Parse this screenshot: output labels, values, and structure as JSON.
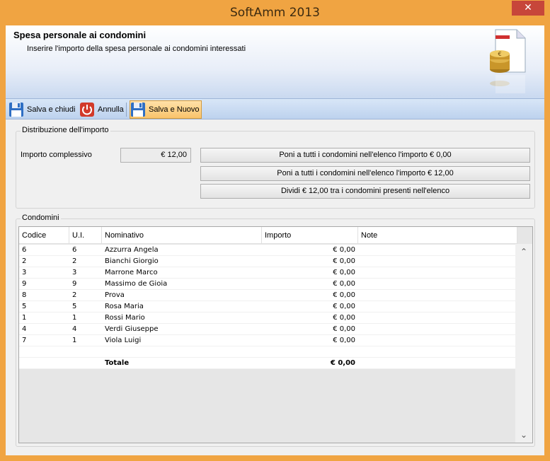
{
  "window": {
    "title": "SoftAmm 2013",
    "close_glyph": "✕"
  },
  "header": {
    "title": "Spesa personale ai condomini",
    "subtitle": "Inserire l'importo della spesa personale ai condomini interessati",
    "icon": "coins-document-icon"
  },
  "toolbar": {
    "save_close": "Salva e chiudi",
    "cancel": "Annulla",
    "save_new": "Salva e Nuovo"
  },
  "distribution": {
    "group_label": "Distribuzione dell'importo",
    "amount_label": "Importo complessivo",
    "amount_value": "€ 12,00",
    "btn_zero": "Poni a tutti i condomini nell'elenco l'importo € 0,00",
    "btn_all": "Poni a tutti i condomini nell'elenco l'importo € 12,00",
    "btn_divide": "Dividi € 12,00 tra i condomini presenti nell'elenco"
  },
  "condomini": {
    "group_label": "Condomini",
    "columns": [
      "Codice",
      "U.I.",
      "Nominativo",
      "Importo",
      "Note"
    ],
    "rows": [
      {
        "codice": "6",
        "ui": "6",
        "nome": "Azzurra Angela",
        "importo": "€ 0,00",
        "note": ""
      },
      {
        "codice": "2",
        "ui": "2",
        "nome": "Bianchi Giorgio",
        "importo": "€ 0,00",
        "note": ""
      },
      {
        "codice": "3",
        "ui": "3",
        "nome": "Marrone Marco",
        "importo": "€ 0,00",
        "note": ""
      },
      {
        "codice": "9",
        "ui": "9",
        "nome": "Massimo de Gioia",
        "importo": "€ 0,00",
        "note": ""
      },
      {
        "codice": "8",
        "ui": "2",
        "nome": "Prova",
        "importo": "€ 0,00",
        "note": ""
      },
      {
        "codice": "5",
        "ui": "5",
        "nome": "Rosa Maria",
        "importo": "€ 0,00",
        "note": ""
      },
      {
        "codice": "1",
        "ui": "1",
        "nome": "Rossi Mario",
        "importo": "€ 0,00",
        "note": ""
      },
      {
        "codice": "4",
        "ui": "4",
        "nome": "Verdi Giuseppe",
        "importo": "€ 0,00",
        "note": ""
      },
      {
        "codice": "7",
        "ui": "1",
        "nome": "Viola Luigi",
        "importo": "€ 0,00",
        "note": ""
      }
    ],
    "total_label": "Totale",
    "total_value": "€ 0,00"
  }
}
